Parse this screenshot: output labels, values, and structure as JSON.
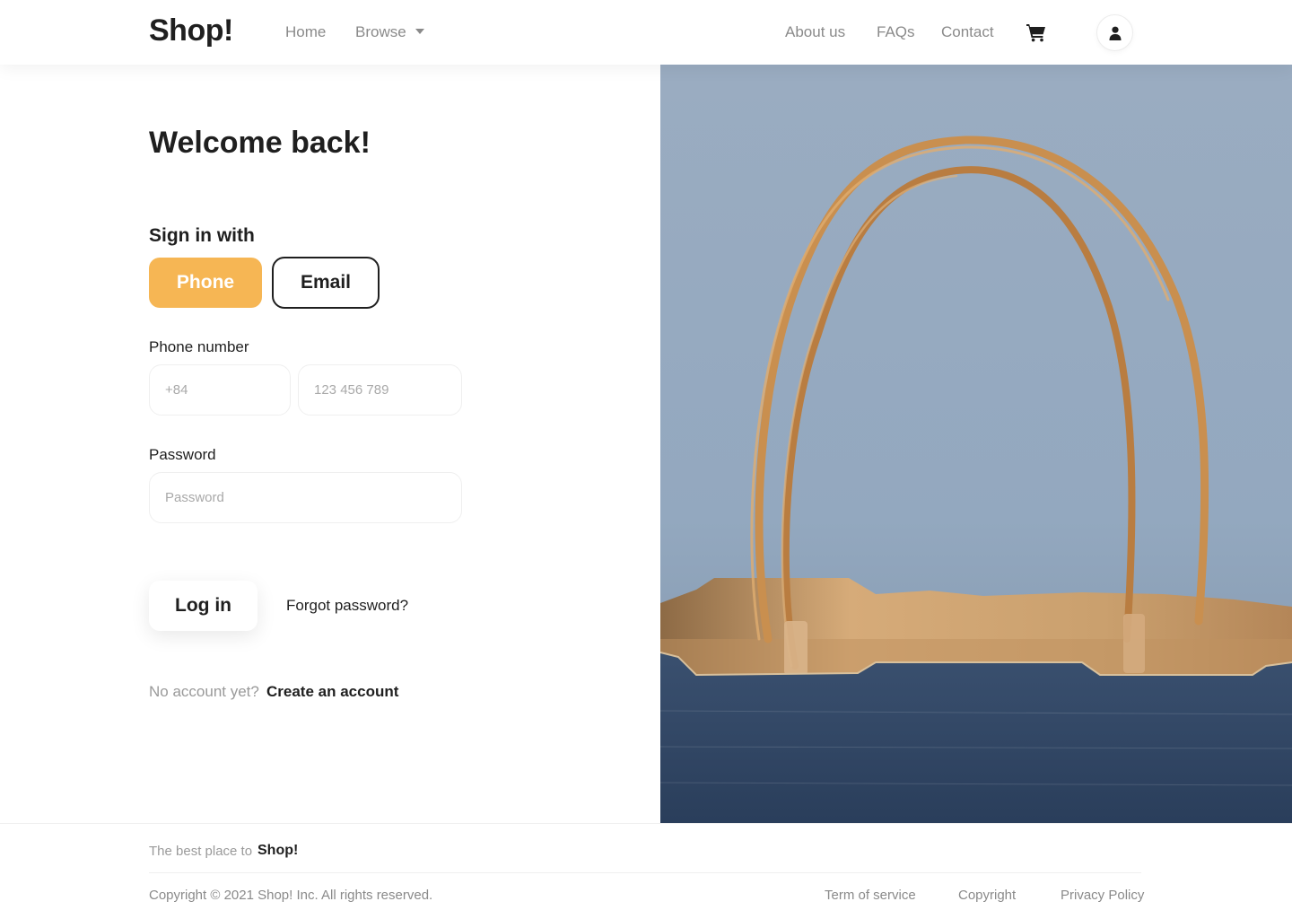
{
  "header": {
    "logo": "Shop!",
    "nav_left": {
      "home": "Home",
      "browse": "Browse"
    },
    "nav_right": {
      "about": "About us",
      "faqs": "FAQs",
      "contact": "Contact"
    },
    "icons": {
      "cart": "shopping-cart-icon",
      "user": "user-icon",
      "browse_caret": "caret-down-icon"
    }
  },
  "login": {
    "title": "Welcome back!",
    "sign_in_with": "Sign in with",
    "methods": {
      "phone": "Phone",
      "email": "Email"
    },
    "active_method": "Phone",
    "phone_label": "Phone number",
    "phone_code_placeholder": "+84",
    "phone_number_placeholder": "123 456 789",
    "password_label": "Password",
    "password_placeholder": "Password",
    "login_button": "Log in",
    "forgot_password": "Forgot password?",
    "no_account": "No account yet?",
    "create_account": "Create an account"
  },
  "footer": {
    "tagline": "The best place to",
    "tagline_brand": "Shop!",
    "copyright": "Copyright © 2021 Shop! Inc. All rights reserved.",
    "links": {
      "terms": "Term of service",
      "copyright": "Copyright",
      "privacy": "Privacy Policy"
    }
  },
  "colors": {
    "accent": "#f6b654",
    "text_dark": "#1f1f1f",
    "text_muted": "#8a8a8a",
    "hero_sky": "#9aaec4",
    "bag_kraft": "#c99a66",
    "bag_denim": "#2e4566"
  }
}
